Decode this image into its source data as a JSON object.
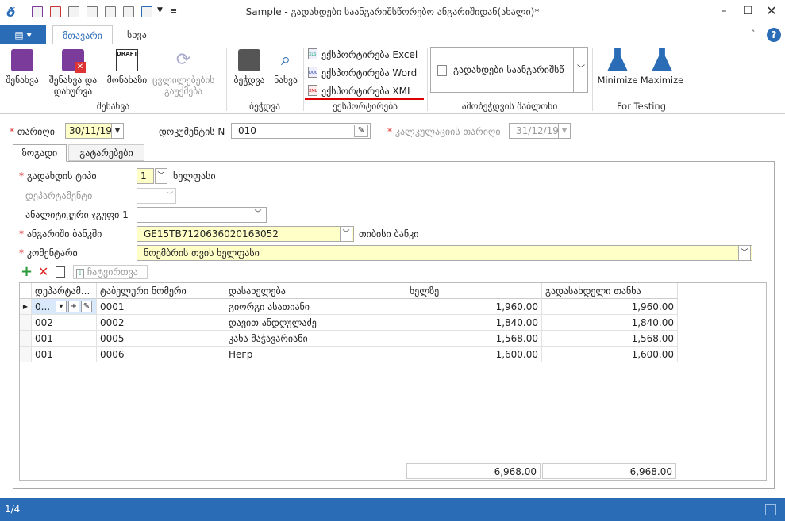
{
  "window": {
    "title": "Sample - გადახდები საანგარიშსწორებო ანგარიშიდან(ახალი)*"
  },
  "ribbon": {
    "file_tab": "▤",
    "tabs": [
      "მთავარი",
      "სხვა"
    ],
    "buttons": {
      "save": "შენახვა",
      "save_close": "შენახვა და დახურვა",
      "draft": "მონახაზი",
      "undo": "ცვლილებების გაუქმება",
      "print": "ბეჭდვა",
      "preview": "ნახვა",
      "minimize": "Minimize",
      "maximize": "Maximize"
    },
    "export": [
      "ექსპორტირება Excel",
      "ექსპორტირება Word",
      "ექსპორტირება XML"
    ],
    "export_icons": [
      "XLS",
      "DOC",
      "XML"
    ],
    "template_select": "გადახდები საანგარიშსწ",
    "groups": [
      "შენახვა",
      "ბეჭდვა",
      "ექსპორტირება",
      "ამობეჭდვის შაბლონი",
      "For Testing"
    ]
  },
  "header": {
    "date_label": "თარიღი",
    "date": "30/11/19",
    "docnum_label": "დოკუმენტის N",
    "docnum": "010",
    "calc_date_label": "კალკულაციის თარიღი",
    "calc_date": "31/12/19"
  },
  "tabs": [
    "ზოგადი",
    "გატარებები"
  ],
  "form": {
    "pay_type_label": "გადახდის ტიპი",
    "pay_type": "1",
    "pay_type_name": "ხელფასი",
    "dept_label": "დეპარტამენტი",
    "analytic_label": "ანალიტიკური ჯგუფი 1",
    "bank_label": "ანგარიში ბანკში",
    "bank": "GE15TB7120636020163052",
    "bank_name": "თიბისი ბანკი",
    "comment_label": "კომენტარი",
    "comment": "ნოემბრის თვის ხელფასი"
  },
  "toolbar": {
    "load": "ჩატვირთვა"
  },
  "grid": {
    "headers": [
      "დეპარტამ...",
      "ტაბელური ნომერი",
      "დასახელება",
      "ხელზე",
      "გადასახდელი თანხა"
    ],
    "rows": [
      {
        "dept": "0...",
        "tab": "0001",
        "name": "გიორგი ასათიანი",
        "hand": "1,960.00",
        "pay": "1,960.00"
      },
      {
        "dept": "002",
        "tab": "0002",
        "name": "დავით ანდღულაძე",
        "hand": "1,840.00",
        "pay": "1,840.00"
      },
      {
        "dept": "001",
        "tab": "0005",
        "name": "კახა მაჭავარიანი",
        "hand": "1,568.00",
        "pay": "1,568.00"
      },
      {
        "dept": "001",
        "tab": "0006",
        "name": "Негр",
        "hand": "1,600.00",
        "pay": "1,600.00"
      }
    ],
    "totals": {
      "hand": "6,968.00",
      "pay": "6,968.00"
    }
  },
  "status": {
    "page": "1/4"
  }
}
